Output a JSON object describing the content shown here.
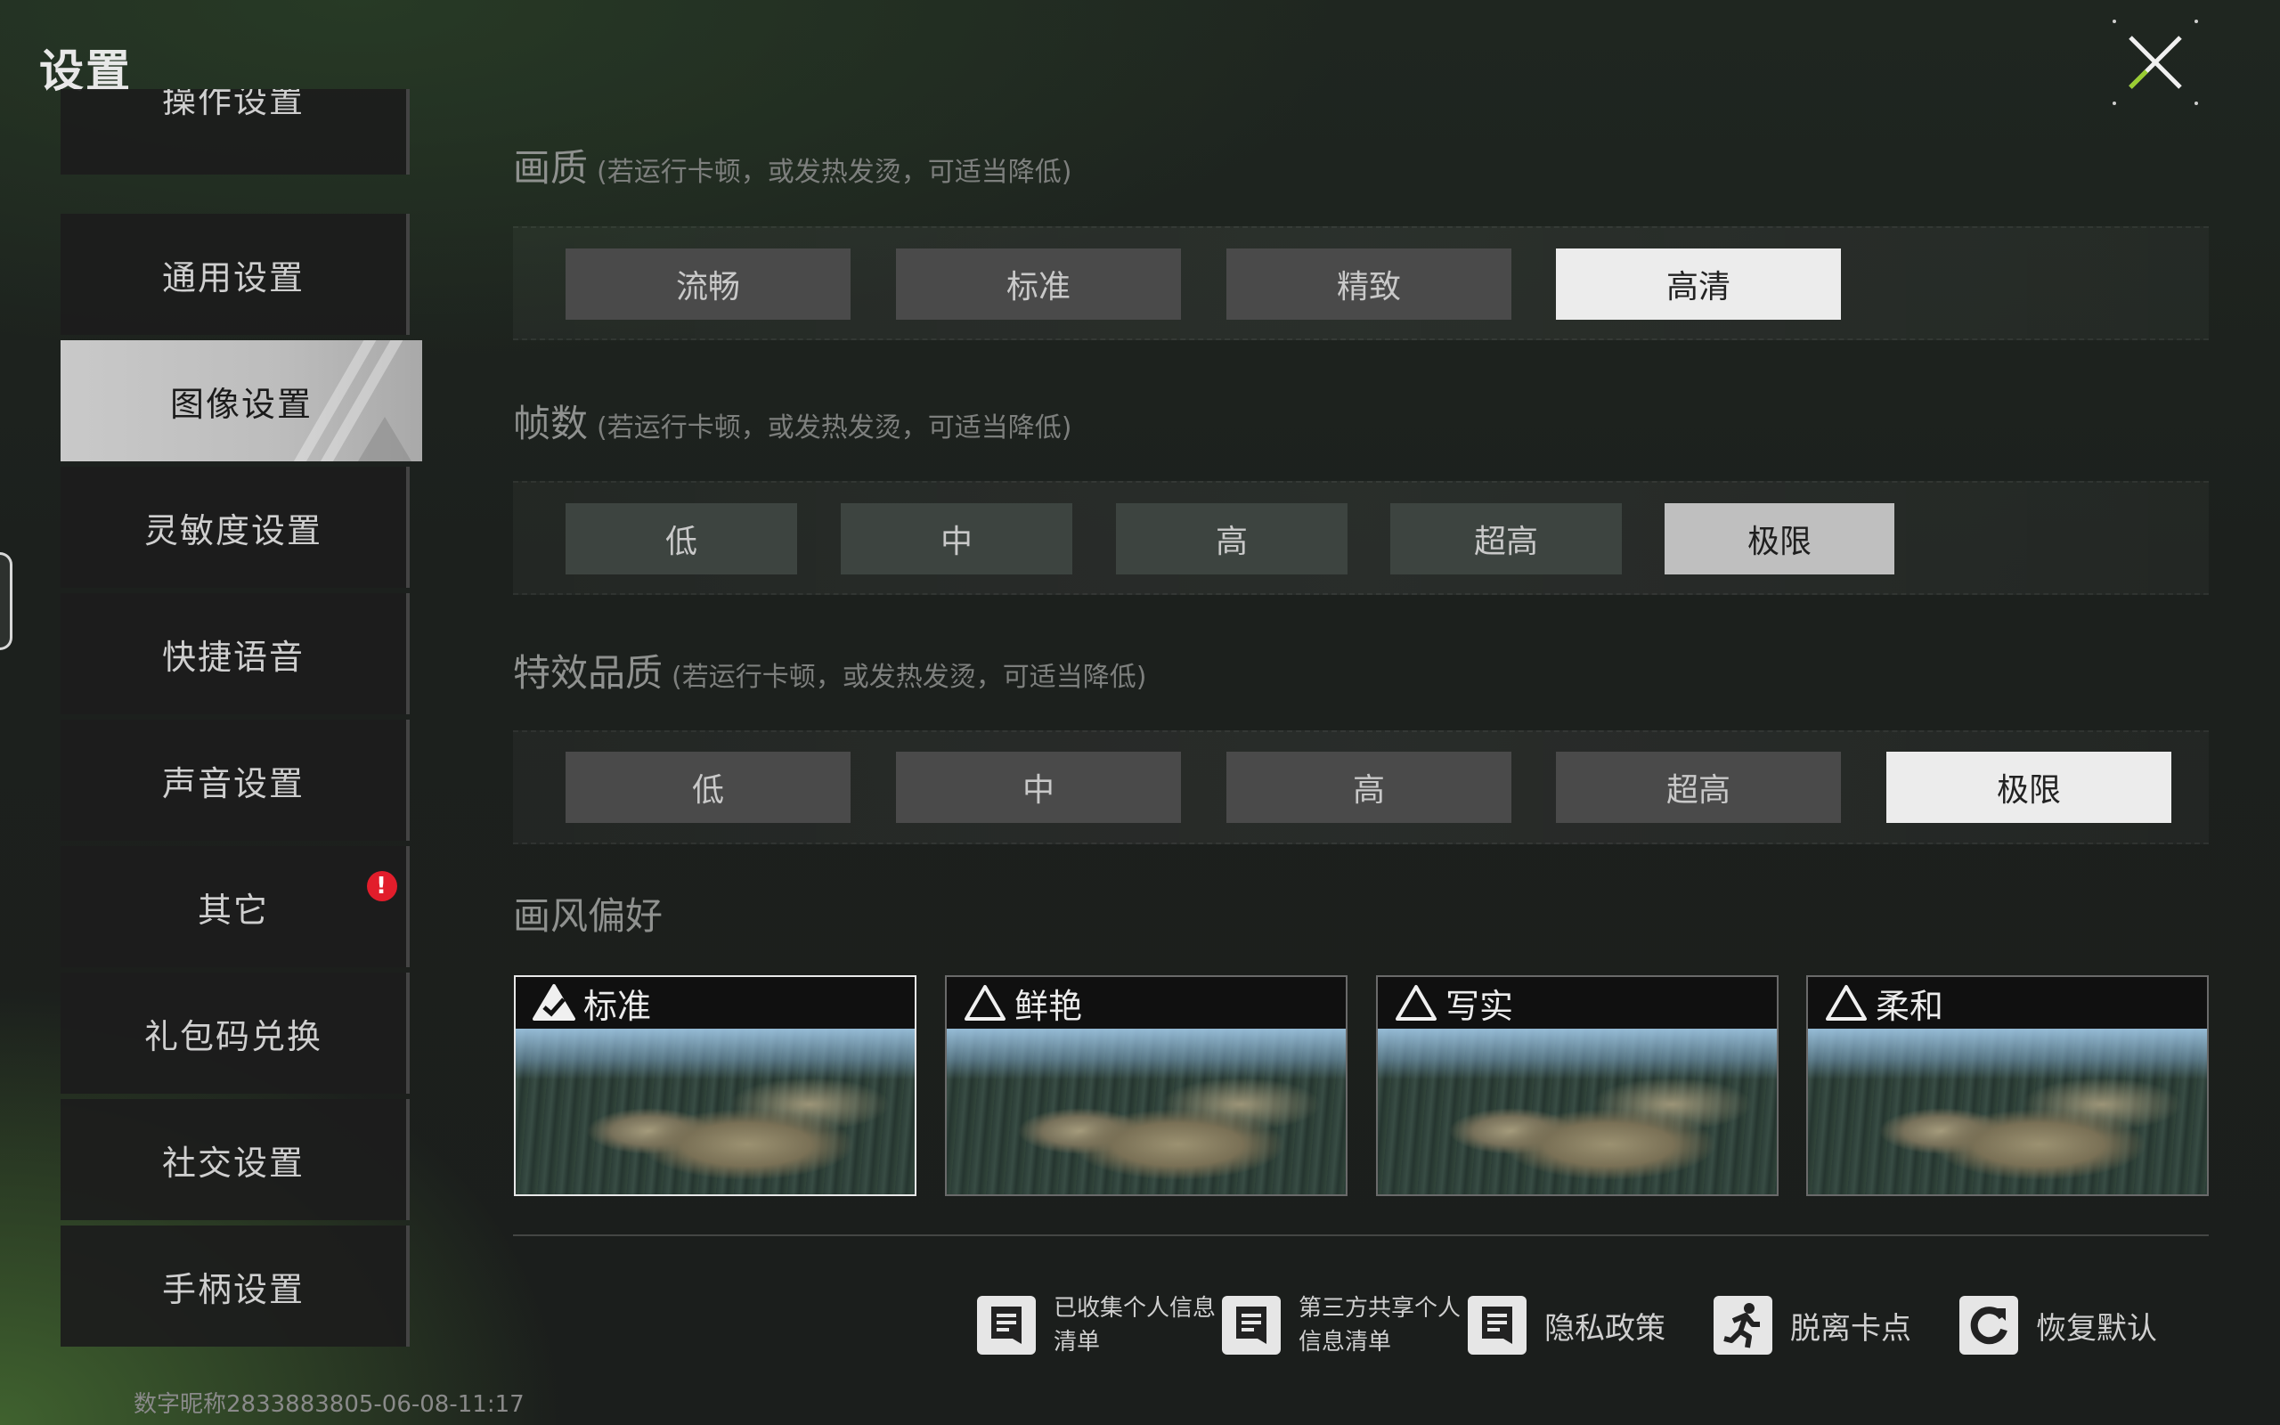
{
  "page": {
    "title": "设置"
  },
  "sidebar": {
    "items": [
      {
        "label": "操作设置"
      },
      {
        "label": "通用设置"
      },
      {
        "label": "图像设置"
      },
      {
        "label": "灵敏度设置"
      },
      {
        "label": "快捷语音"
      },
      {
        "label": "声音设置"
      },
      {
        "label": "其它",
        "badge": "!"
      },
      {
        "label": "礼包码兑换"
      },
      {
        "label": "社交设置"
      },
      {
        "label": "手柄设置"
      }
    ],
    "active": "图像设置"
  },
  "quality": {
    "title": "画质",
    "hint": "(若运行卡顿，或发热发烫，可适当降低)",
    "options": [
      "流畅",
      "标准",
      "精致",
      "高清"
    ],
    "selected": "高清"
  },
  "fps": {
    "title": "帧数",
    "hint": "(若运行卡顿，或发热发烫，可适当降低)",
    "options": [
      "低",
      "中",
      "高",
      "超高",
      "极限"
    ],
    "selected": "极限"
  },
  "effects": {
    "title": "特效品质",
    "hint": "(若运行卡顿，或发热发烫，可适当降低)",
    "options": [
      "低",
      "中",
      "高",
      "超高",
      "极限"
    ],
    "selected": "极限"
  },
  "style": {
    "title": "画风偏好",
    "options": [
      "标准",
      "鲜艳",
      "写实",
      "柔和"
    ],
    "selected": "标准"
  },
  "footer": {
    "collected_info": "已收集个人信息清单",
    "third_party": "第三方共享个人信息清单",
    "privacy": "隐私政策",
    "unstuck": "脱离卡点",
    "reset": "恢复默认"
  },
  "id_text": "数字昵称2833883805-06-08-11:17",
  "colors": {
    "selected": "#ececec",
    "option": "#4a4a4a",
    "badge": "#e21d2b"
  }
}
